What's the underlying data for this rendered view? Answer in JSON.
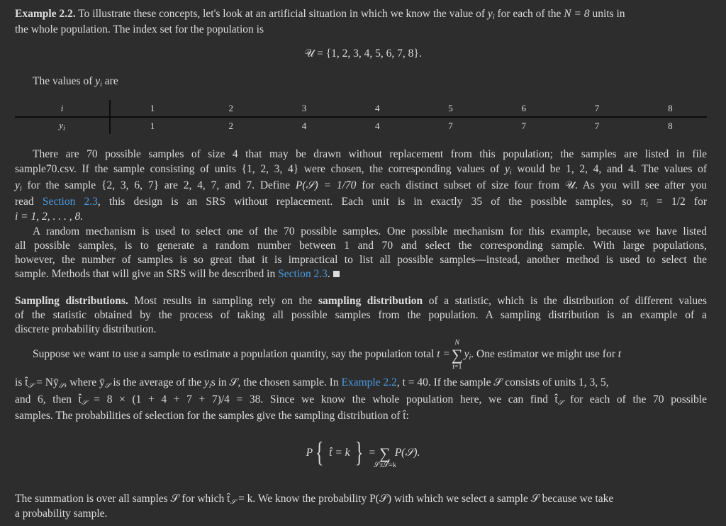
{
  "example": {
    "label": "Example 2.2.",
    "line1": " To illustrate these concepts, let's look at an artificial situation in which we know the value of ",
    "yi": "y",
    "i_sub": "i",
    "line1b": " for each of the ",
    "N_eq": "N = 8",
    "line1c": " units in",
    "line2": "the whole population. The index set for the population is",
    "index_set": "𝒰 = {1, 2, 3, 4, 5, 6, 7, 8}.",
    "values_intro_a": "The values of ",
    "values_intro_b": " are"
  },
  "table": {
    "header_label": "i",
    "row_label": "y",
    "row_label_sub": "i",
    "i_values": [
      "1",
      "2",
      "3",
      "4",
      "5",
      "6",
      "7",
      "8"
    ],
    "y_values": [
      "1",
      "2",
      "4",
      "4",
      "7",
      "7",
      "7",
      "8"
    ]
  },
  "para1": {
    "l1": "There are 70 possible samples of size 4 that may be drawn without replacement from this population; the samples are listed in file",
    "l2a": "sample70.csv. If the sample consisting of units {1, 2, 3, 4} were chosen, the corresponding values of ",
    "l2b": " would be 1, 2, 4, and 4. The values of",
    "l3a": " for the sample {2, 3, 6, 7} are 2, 4, 7, and 7. Define ",
    "l3b": "P(𝒮) = 1/70",
    "l3c": " for each distinct subset of size four from 𝒰. As you will see after you",
    "l4a": "read ",
    "l4_link": "Section 2.3",
    "l4b": ", this design is an SRS without replacement. Each unit is in exactly 35 of the possible samples, so ",
    "l4_pi": "π",
    "l4c": " = 1/2 for",
    "l5": "i = 1, 2, . . . , 8."
  },
  "para2": {
    "l1": "A random mechanism is used to select one of the 70 possible samples. One possible mechanism for this example, because we have listed",
    "l2": "all possible samples, is to generate a random number between 1 and 70 and select the corresponding sample. With large populations,",
    "l3": "however, the number of samples is so great that it is impractical to list all possible samples—instead, another method is used to select the",
    "l4a": "sample. Methods that will give an SRS will be described in ",
    "l4_link": "Section 2.3",
    "l4b": "."
  },
  "sampling": {
    "heading": "Sampling distributions.",
    "l1a": " Most results in sampling rely on the ",
    "l1_bold": "sampling distribution",
    "l1b": " of a statistic, which is the distribution of different values",
    "l2": "of the statistic obtained by the process of taking all possible samples from the population. A sampling distribution is an example of a",
    "l3": "discrete probability distribution."
  },
  "para3": {
    "l1a": "Suppose we want to use a sample to estimate a population quantity, say the population total ",
    "l1_t": "t =",
    "sum_top": "N",
    "sum_bot": "i=1",
    "l1_y": "y",
    "l1b": ". One estimator we might use for ",
    "l1_t2": "t",
    "l2a": "is t̂",
    "l2b": " = Nȳ",
    "l2c": ", where ȳ",
    "l2d": " is the average of the ",
    "l2e": "s in 𝒮, the chosen sample. In ",
    "l2_link": "Example 2.2",
    "l2f": ", t = 40. If the sample 𝒮 consists of units 1, 3, 5,",
    "l3a": "and 6, then t̂",
    "l3b": " = 8 × (1 + 4 + 7 + 7)/4 = 38. Since we know the whole population here, we can find t̂",
    "l3c": " for each of the 70 possible",
    "l4": "samples. The probabilities of selection for the samples give the sampling distribution of t̂:"
  },
  "equation": {
    "P": "P",
    "inner": "t̂ = k",
    "eq": "=",
    "sum_bot": "𝒮:t̂𝒮=k",
    "rhs": "P(𝒮)."
  },
  "final": {
    "l1a": "The summation is over all samples 𝒮 for which t̂",
    "l1b": " = k. We know the probability P(𝒮) with which we select a sample 𝒮 because we take",
    "l2": "a probability sample."
  },
  "script_S": "𝒮",
  "colors": {
    "background": "#2d2d2d",
    "text": "#dcdcdc",
    "link": "#4a9be0"
  }
}
